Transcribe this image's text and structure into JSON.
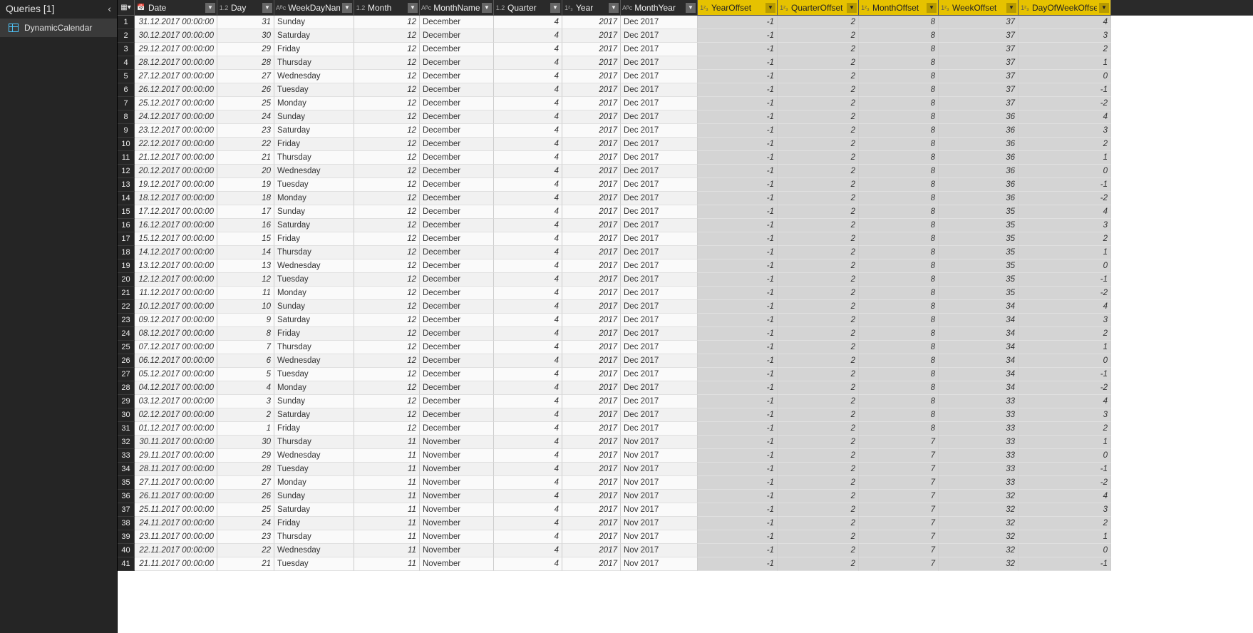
{
  "sidebar": {
    "title": "Queries [1]",
    "items": [
      {
        "label": "DynamicCalendar",
        "selected": true
      }
    ]
  },
  "columns": [
    {
      "key": "date",
      "label": "Date",
      "type": "datetime",
      "wclass": "w-date",
      "highlight": false,
      "align": "num"
    },
    {
      "key": "day",
      "label": "Day",
      "type": "decimal",
      "wclass": "w-day",
      "highlight": false,
      "align": "num"
    },
    {
      "key": "weekdayname",
      "label": "WeekDayName",
      "type": "text",
      "wclass": "w-wdn",
      "highlight": false,
      "align": "txt"
    },
    {
      "key": "month",
      "label": "Month",
      "type": "decimal",
      "wclass": "w-month",
      "highlight": false,
      "align": "num"
    },
    {
      "key": "monthname",
      "label": "MonthName",
      "type": "text",
      "wclass": "w-mname",
      "highlight": false,
      "align": "txt"
    },
    {
      "key": "quarter",
      "label": "Quarter",
      "type": "decimal",
      "wclass": "w-quarter",
      "highlight": false,
      "align": "num"
    },
    {
      "key": "year",
      "label": "Year",
      "type": "int",
      "wclass": "w-year",
      "highlight": false,
      "align": "num"
    },
    {
      "key": "monthyear",
      "label": "MonthYear",
      "type": "text",
      "wclass": "w-myear",
      "highlight": false,
      "align": "txt"
    },
    {
      "key": "yearoffset",
      "label": "YearOffset",
      "type": "int",
      "wclass": "w-yo",
      "highlight": true,
      "align": "num"
    },
    {
      "key": "quarteroffset",
      "label": "QuarterOffset",
      "type": "int",
      "wclass": "w-qo",
      "highlight": true,
      "align": "num"
    },
    {
      "key": "monthoffset",
      "label": "MonthOffset",
      "type": "int",
      "wclass": "w-mo",
      "highlight": true,
      "align": "num"
    },
    {
      "key": "weekoffset",
      "label": "WeekOffset",
      "type": "int",
      "wclass": "w-wo",
      "highlight": true,
      "align": "num"
    },
    {
      "key": "dayofweekoffset",
      "label": "DayOfWeekOffset",
      "type": "int",
      "wclass": "w-dwo",
      "highlight": true,
      "align": "num"
    }
  ],
  "type_icons": {
    "datetime": "📅",
    "decimal": "1.2",
    "text": "Aᴮc",
    "int": "1²₃"
  },
  "rows": [
    {
      "n": 1,
      "date": "31.12.2017 00:00:00",
      "day": 31,
      "weekdayname": "Sunday",
      "month": 12,
      "monthname": "December",
      "quarter": 4,
      "year": 2017,
      "monthyear": "Dec 2017",
      "yearoffset": -1,
      "quarteroffset": 2,
      "monthoffset": 8,
      "weekoffset": 37,
      "dayofweekoffset": 4
    },
    {
      "n": 2,
      "date": "30.12.2017 00:00:00",
      "day": 30,
      "weekdayname": "Saturday",
      "month": 12,
      "monthname": "December",
      "quarter": 4,
      "year": 2017,
      "monthyear": "Dec 2017",
      "yearoffset": -1,
      "quarteroffset": 2,
      "monthoffset": 8,
      "weekoffset": 37,
      "dayofweekoffset": 3
    },
    {
      "n": 3,
      "date": "29.12.2017 00:00:00",
      "day": 29,
      "weekdayname": "Friday",
      "month": 12,
      "monthname": "December",
      "quarter": 4,
      "year": 2017,
      "monthyear": "Dec 2017",
      "yearoffset": -1,
      "quarteroffset": 2,
      "monthoffset": 8,
      "weekoffset": 37,
      "dayofweekoffset": 2
    },
    {
      "n": 4,
      "date": "28.12.2017 00:00:00",
      "day": 28,
      "weekdayname": "Thursday",
      "month": 12,
      "monthname": "December",
      "quarter": 4,
      "year": 2017,
      "monthyear": "Dec 2017",
      "yearoffset": -1,
      "quarteroffset": 2,
      "monthoffset": 8,
      "weekoffset": 37,
      "dayofweekoffset": 1
    },
    {
      "n": 5,
      "date": "27.12.2017 00:00:00",
      "day": 27,
      "weekdayname": "Wednesday",
      "month": 12,
      "monthname": "December",
      "quarter": 4,
      "year": 2017,
      "monthyear": "Dec 2017",
      "yearoffset": -1,
      "quarteroffset": 2,
      "monthoffset": 8,
      "weekoffset": 37,
      "dayofweekoffset": 0
    },
    {
      "n": 6,
      "date": "26.12.2017 00:00:00",
      "day": 26,
      "weekdayname": "Tuesday",
      "month": 12,
      "monthname": "December",
      "quarter": 4,
      "year": 2017,
      "monthyear": "Dec 2017",
      "yearoffset": -1,
      "quarteroffset": 2,
      "monthoffset": 8,
      "weekoffset": 37,
      "dayofweekoffset": -1
    },
    {
      "n": 7,
      "date": "25.12.2017 00:00:00",
      "day": 25,
      "weekdayname": "Monday",
      "month": 12,
      "monthname": "December",
      "quarter": 4,
      "year": 2017,
      "monthyear": "Dec 2017",
      "yearoffset": -1,
      "quarteroffset": 2,
      "monthoffset": 8,
      "weekoffset": 37,
      "dayofweekoffset": -2
    },
    {
      "n": 8,
      "date": "24.12.2017 00:00:00",
      "day": 24,
      "weekdayname": "Sunday",
      "month": 12,
      "monthname": "December",
      "quarter": 4,
      "year": 2017,
      "monthyear": "Dec 2017",
      "yearoffset": -1,
      "quarteroffset": 2,
      "monthoffset": 8,
      "weekoffset": 36,
      "dayofweekoffset": 4
    },
    {
      "n": 9,
      "date": "23.12.2017 00:00:00",
      "day": 23,
      "weekdayname": "Saturday",
      "month": 12,
      "monthname": "December",
      "quarter": 4,
      "year": 2017,
      "monthyear": "Dec 2017",
      "yearoffset": -1,
      "quarteroffset": 2,
      "monthoffset": 8,
      "weekoffset": 36,
      "dayofweekoffset": 3
    },
    {
      "n": 10,
      "date": "22.12.2017 00:00:00",
      "day": 22,
      "weekdayname": "Friday",
      "month": 12,
      "monthname": "December",
      "quarter": 4,
      "year": 2017,
      "monthyear": "Dec 2017",
      "yearoffset": -1,
      "quarteroffset": 2,
      "monthoffset": 8,
      "weekoffset": 36,
      "dayofweekoffset": 2
    },
    {
      "n": 11,
      "date": "21.12.2017 00:00:00",
      "day": 21,
      "weekdayname": "Thursday",
      "month": 12,
      "monthname": "December",
      "quarter": 4,
      "year": 2017,
      "monthyear": "Dec 2017",
      "yearoffset": -1,
      "quarteroffset": 2,
      "monthoffset": 8,
      "weekoffset": 36,
      "dayofweekoffset": 1
    },
    {
      "n": 12,
      "date": "20.12.2017 00:00:00",
      "day": 20,
      "weekdayname": "Wednesday",
      "month": 12,
      "monthname": "December",
      "quarter": 4,
      "year": 2017,
      "monthyear": "Dec 2017",
      "yearoffset": -1,
      "quarteroffset": 2,
      "monthoffset": 8,
      "weekoffset": 36,
      "dayofweekoffset": 0
    },
    {
      "n": 13,
      "date": "19.12.2017 00:00:00",
      "day": 19,
      "weekdayname": "Tuesday",
      "month": 12,
      "monthname": "December",
      "quarter": 4,
      "year": 2017,
      "monthyear": "Dec 2017",
      "yearoffset": -1,
      "quarteroffset": 2,
      "monthoffset": 8,
      "weekoffset": 36,
      "dayofweekoffset": -1
    },
    {
      "n": 14,
      "date": "18.12.2017 00:00:00",
      "day": 18,
      "weekdayname": "Monday",
      "month": 12,
      "monthname": "December",
      "quarter": 4,
      "year": 2017,
      "monthyear": "Dec 2017",
      "yearoffset": -1,
      "quarteroffset": 2,
      "monthoffset": 8,
      "weekoffset": 36,
      "dayofweekoffset": -2
    },
    {
      "n": 15,
      "date": "17.12.2017 00:00:00",
      "day": 17,
      "weekdayname": "Sunday",
      "month": 12,
      "monthname": "December",
      "quarter": 4,
      "year": 2017,
      "monthyear": "Dec 2017",
      "yearoffset": -1,
      "quarteroffset": 2,
      "monthoffset": 8,
      "weekoffset": 35,
      "dayofweekoffset": 4
    },
    {
      "n": 16,
      "date": "16.12.2017 00:00:00",
      "day": 16,
      "weekdayname": "Saturday",
      "month": 12,
      "monthname": "December",
      "quarter": 4,
      "year": 2017,
      "monthyear": "Dec 2017",
      "yearoffset": -1,
      "quarteroffset": 2,
      "monthoffset": 8,
      "weekoffset": 35,
      "dayofweekoffset": 3
    },
    {
      "n": 17,
      "date": "15.12.2017 00:00:00",
      "day": 15,
      "weekdayname": "Friday",
      "month": 12,
      "monthname": "December",
      "quarter": 4,
      "year": 2017,
      "monthyear": "Dec 2017",
      "yearoffset": -1,
      "quarteroffset": 2,
      "monthoffset": 8,
      "weekoffset": 35,
      "dayofweekoffset": 2
    },
    {
      "n": 18,
      "date": "14.12.2017 00:00:00",
      "day": 14,
      "weekdayname": "Thursday",
      "month": 12,
      "monthname": "December",
      "quarter": 4,
      "year": 2017,
      "monthyear": "Dec 2017",
      "yearoffset": -1,
      "quarteroffset": 2,
      "monthoffset": 8,
      "weekoffset": 35,
      "dayofweekoffset": 1
    },
    {
      "n": 19,
      "date": "13.12.2017 00:00:00",
      "day": 13,
      "weekdayname": "Wednesday",
      "month": 12,
      "monthname": "December",
      "quarter": 4,
      "year": 2017,
      "monthyear": "Dec 2017",
      "yearoffset": -1,
      "quarteroffset": 2,
      "monthoffset": 8,
      "weekoffset": 35,
      "dayofweekoffset": 0
    },
    {
      "n": 20,
      "date": "12.12.2017 00:00:00",
      "day": 12,
      "weekdayname": "Tuesday",
      "month": 12,
      "monthname": "December",
      "quarter": 4,
      "year": 2017,
      "monthyear": "Dec 2017",
      "yearoffset": -1,
      "quarteroffset": 2,
      "monthoffset": 8,
      "weekoffset": 35,
      "dayofweekoffset": -1
    },
    {
      "n": 21,
      "date": "11.12.2017 00:00:00",
      "day": 11,
      "weekdayname": "Monday",
      "month": 12,
      "monthname": "December",
      "quarter": 4,
      "year": 2017,
      "monthyear": "Dec 2017",
      "yearoffset": -1,
      "quarteroffset": 2,
      "monthoffset": 8,
      "weekoffset": 35,
      "dayofweekoffset": -2
    },
    {
      "n": 22,
      "date": "10.12.2017 00:00:00",
      "day": 10,
      "weekdayname": "Sunday",
      "month": 12,
      "monthname": "December",
      "quarter": 4,
      "year": 2017,
      "monthyear": "Dec 2017",
      "yearoffset": -1,
      "quarteroffset": 2,
      "monthoffset": 8,
      "weekoffset": 34,
      "dayofweekoffset": 4
    },
    {
      "n": 23,
      "date": "09.12.2017 00:00:00",
      "day": 9,
      "weekdayname": "Saturday",
      "month": 12,
      "monthname": "December",
      "quarter": 4,
      "year": 2017,
      "monthyear": "Dec 2017",
      "yearoffset": -1,
      "quarteroffset": 2,
      "monthoffset": 8,
      "weekoffset": 34,
      "dayofweekoffset": 3
    },
    {
      "n": 24,
      "date": "08.12.2017 00:00:00",
      "day": 8,
      "weekdayname": "Friday",
      "month": 12,
      "monthname": "December",
      "quarter": 4,
      "year": 2017,
      "monthyear": "Dec 2017",
      "yearoffset": -1,
      "quarteroffset": 2,
      "monthoffset": 8,
      "weekoffset": 34,
      "dayofweekoffset": 2
    },
    {
      "n": 25,
      "date": "07.12.2017 00:00:00",
      "day": 7,
      "weekdayname": "Thursday",
      "month": 12,
      "monthname": "December",
      "quarter": 4,
      "year": 2017,
      "monthyear": "Dec 2017",
      "yearoffset": -1,
      "quarteroffset": 2,
      "monthoffset": 8,
      "weekoffset": 34,
      "dayofweekoffset": 1
    },
    {
      "n": 26,
      "date": "06.12.2017 00:00:00",
      "day": 6,
      "weekdayname": "Wednesday",
      "month": 12,
      "monthname": "December",
      "quarter": 4,
      "year": 2017,
      "monthyear": "Dec 2017",
      "yearoffset": -1,
      "quarteroffset": 2,
      "monthoffset": 8,
      "weekoffset": 34,
      "dayofweekoffset": 0
    },
    {
      "n": 27,
      "date": "05.12.2017 00:00:00",
      "day": 5,
      "weekdayname": "Tuesday",
      "month": 12,
      "monthname": "December",
      "quarter": 4,
      "year": 2017,
      "monthyear": "Dec 2017",
      "yearoffset": -1,
      "quarteroffset": 2,
      "monthoffset": 8,
      "weekoffset": 34,
      "dayofweekoffset": -1
    },
    {
      "n": 28,
      "date": "04.12.2017 00:00:00",
      "day": 4,
      "weekdayname": "Monday",
      "month": 12,
      "monthname": "December",
      "quarter": 4,
      "year": 2017,
      "monthyear": "Dec 2017",
      "yearoffset": -1,
      "quarteroffset": 2,
      "monthoffset": 8,
      "weekoffset": 34,
      "dayofweekoffset": -2
    },
    {
      "n": 29,
      "date": "03.12.2017 00:00:00",
      "day": 3,
      "weekdayname": "Sunday",
      "month": 12,
      "monthname": "December",
      "quarter": 4,
      "year": 2017,
      "monthyear": "Dec 2017",
      "yearoffset": -1,
      "quarteroffset": 2,
      "monthoffset": 8,
      "weekoffset": 33,
      "dayofweekoffset": 4
    },
    {
      "n": 30,
      "date": "02.12.2017 00:00:00",
      "day": 2,
      "weekdayname": "Saturday",
      "month": 12,
      "monthname": "December",
      "quarter": 4,
      "year": 2017,
      "monthyear": "Dec 2017",
      "yearoffset": -1,
      "quarteroffset": 2,
      "monthoffset": 8,
      "weekoffset": 33,
      "dayofweekoffset": 3
    },
    {
      "n": 31,
      "date": "01.12.2017 00:00:00",
      "day": 1,
      "weekdayname": "Friday",
      "month": 12,
      "monthname": "December",
      "quarter": 4,
      "year": 2017,
      "monthyear": "Dec 2017",
      "yearoffset": -1,
      "quarteroffset": 2,
      "monthoffset": 8,
      "weekoffset": 33,
      "dayofweekoffset": 2
    },
    {
      "n": 32,
      "date": "30.11.2017 00:00:00",
      "day": 30,
      "weekdayname": "Thursday",
      "month": 11,
      "monthname": "November",
      "quarter": 4,
      "year": 2017,
      "monthyear": "Nov 2017",
      "yearoffset": -1,
      "quarteroffset": 2,
      "monthoffset": 7,
      "weekoffset": 33,
      "dayofweekoffset": 1
    },
    {
      "n": 33,
      "date": "29.11.2017 00:00:00",
      "day": 29,
      "weekdayname": "Wednesday",
      "month": 11,
      "monthname": "November",
      "quarter": 4,
      "year": 2017,
      "monthyear": "Nov 2017",
      "yearoffset": -1,
      "quarteroffset": 2,
      "monthoffset": 7,
      "weekoffset": 33,
      "dayofweekoffset": 0
    },
    {
      "n": 34,
      "date": "28.11.2017 00:00:00",
      "day": 28,
      "weekdayname": "Tuesday",
      "month": 11,
      "monthname": "November",
      "quarter": 4,
      "year": 2017,
      "monthyear": "Nov 2017",
      "yearoffset": -1,
      "quarteroffset": 2,
      "monthoffset": 7,
      "weekoffset": 33,
      "dayofweekoffset": -1
    },
    {
      "n": 35,
      "date": "27.11.2017 00:00:00",
      "day": 27,
      "weekdayname": "Monday",
      "month": 11,
      "monthname": "November",
      "quarter": 4,
      "year": 2017,
      "monthyear": "Nov 2017",
      "yearoffset": -1,
      "quarteroffset": 2,
      "monthoffset": 7,
      "weekoffset": 33,
      "dayofweekoffset": -2
    },
    {
      "n": 36,
      "date": "26.11.2017 00:00:00",
      "day": 26,
      "weekdayname": "Sunday",
      "month": 11,
      "monthname": "November",
      "quarter": 4,
      "year": 2017,
      "monthyear": "Nov 2017",
      "yearoffset": -1,
      "quarteroffset": 2,
      "monthoffset": 7,
      "weekoffset": 32,
      "dayofweekoffset": 4
    },
    {
      "n": 37,
      "date": "25.11.2017 00:00:00",
      "day": 25,
      "weekdayname": "Saturday",
      "month": 11,
      "monthname": "November",
      "quarter": 4,
      "year": 2017,
      "monthyear": "Nov 2017",
      "yearoffset": -1,
      "quarteroffset": 2,
      "monthoffset": 7,
      "weekoffset": 32,
      "dayofweekoffset": 3
    },
    {
      "n": 38,
      "date": "24.11.2017 00:00:00",
      "day": 24,
      "weekdayname": "Friday",
      "month": 11,
      "monthname": "November",
      "quarter": 4,
      "year": 2017,
      "monthyear": "Nov 2017",
      "yearoffset": -1,
      "quarteroffset": 2,
      "monthoffset": 7,
      "weekoffset": 32,
      "dayofweekoffset": 2
    },
    {
      "n": 39,
      "date": "23.11.2017 00:00:00",
      "day": 23,
      "weekdayname": "Thursday",
      "month": 11,
      "monthname": "November",
      "quarter": 4,
      "year": 2017,
      "monthyear": "Nov 2017",
      "yearoffset": -1,
      "quarteroffset": 2,
      "monthoffset": 7,
      "weekoffset": 32,
      "dayofweekoffset": 1
    },
    {
      "n": 40,
      "date": "22.11.2017 00:00:00",
      "day": 22,
      "weekdayname": "Wednesday",
      "month": 11,
      "monthname": "November",
      "quarter": 4,
      "year": 2017,
      "monthyear": "Nov 2017",
      "yearoffset": -1,
      "quarteroffset": 2,
      "monthoffset": 7,
      "weekoffset": 32,
      "dayofweekoffset": 0
    },
    {
      "n": 41,
      "date": "21.11.2017 00:00:00",
      "day": 21,
      "weekdayname": "Tuesday",
      "month": 11,
      "monthname": "November",
      "quarter": 4,
      "year": 2017,
      "monthyear": "Nov 2017",
      "yearoffset": -1,
      "quarteroffset": 2,
      "monthoffset": 7,
      "weekoffset": 32,
      "dayofweekoffset": -1
    }
  ]
}
